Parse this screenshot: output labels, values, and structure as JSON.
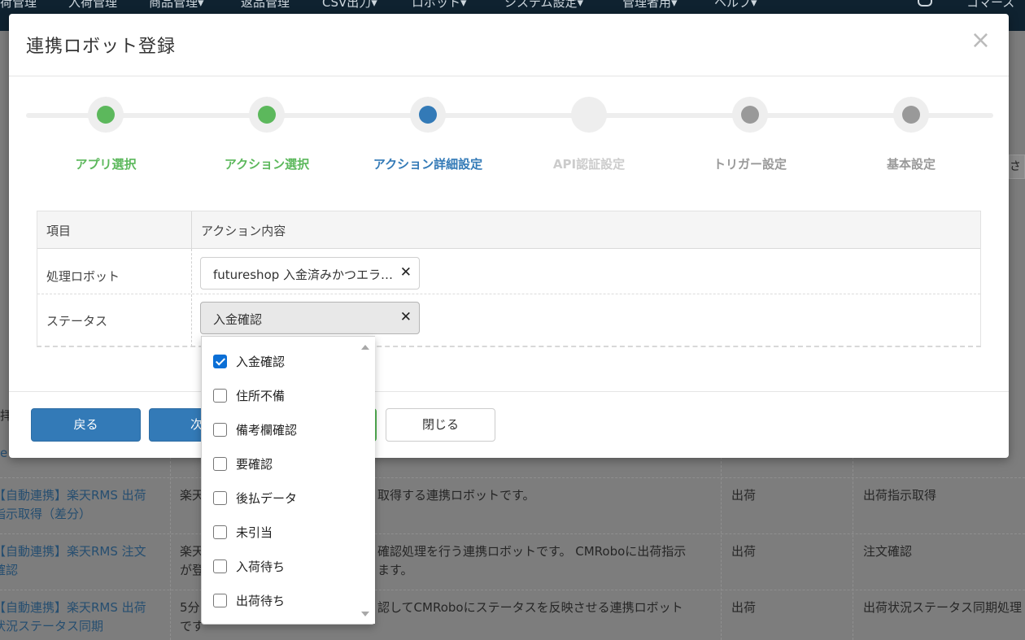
{
  "nav": {
    "items": [
      "荷管理",
      "入荷管理",
      "商品管理▾",
      "返品管理",
      "CSV出力▾",
      "ロボット▾",
      "システム設定▾",
      "管理者用▾",
      "ヘルプ▾"
    ],
    "user": "コマース"
  },
  "background": {
    "sliver_text": "さい",
    "left_fragments": [
      "拝",
      "e"
    ],
    "rows": [
      {
        "name_line1": "【自動連携】楽天RMS 出荷",
        "name_line2": "指示取得（差分）",
        "desc_line1": "楽天",
        "desc_line2": "",
        "desc_tail1": "取得する連携ロボットです。",
        "desc_tail2": "",
        "type": "出荷",
        "action": "出荷指示取得"
      },
      {
        "name_line1": "【自動連携】楽天RMS 注文",
        "name_line2": "確認",
        "desc_line1": "楽天",
        "desc_line2": "が登",
        "desc_tail1": "確認処理を行う連携ロボットです。 CMRoboに出荷指示",
        "desc_tail2": "ます。",
        "type": "出荷",
        "action": "注文確認"
      },
      {
        "name_line1": "【自動連携】楽天RMS 出荷",
        "name_line2": "状況ステータス同期",
        "desc_line1": "5分",
        "desc_line2": "です",
        "desc_tail1": "認してCMRoboにステータスを反映させる連携ロボット",
        "desc_tail2": "",
        "type": "出荷",
        "action": "出荷状況ステータス同期処理"
      }
    ]
  },
  "modal": {
    "title": "連携ロボット登録",
    "steps": [
      {
        "label": "アプリ選択",
        "state": "done"
      },
      {
        "label": "アクション選択",
        "state": "done"
      },
      {
        "label": "アクション詳細設定",
        "state": "current"
      },
      {
        "label": "API認証設定",
        "state": "disabled"
      },
      {
        "label": "トリガー設定",
        "state": "pending"
      },
      {
        "label": "基本設定",
        "state": "pending"
      }
    ],
    "colors": {
      "done": "#5cb85c",
      "current": "#337ab7",
      "pending": "#999999",
      "disabled": "#cccccc"
    },
    "table": {
      "col_item": "項目",
      "col_action": "アクション内容",
      "rows": [
        {
          "label": "処理ロボット",
          "value": "futureshop 入金済みかつエラー受注"
        },
        {
          "label": "ステータス",
          "value": "入金確認"
        }
      ]
    },
    "buttons": {
      "back": "戻る",
      "next": "次",
      "close": "閉じる"
    }
  },
  "dropdown": {
    "options": [
      {
        "label": "入金確認",
        "checked": true
      },
      {
        "label": "住所不備",
        "checked": false
      },
      {
        "label": "備考欄確認",
        "checked": false
      },
      {
        "label": "要確認",
        "checked": false
      },
      {
        "label": "後払データ",
        "checked": false
      },
      {
        "label": "未引当",
        "checked": false
      },
      {
        "label": "入荷待ち",
        "checked": false
      },
      {
        "label": "出荷待ち",
        "checked": false
      }
    ]
  },
  "icons": {
    "close": "×",
    "clear": "✕"
  }
}
